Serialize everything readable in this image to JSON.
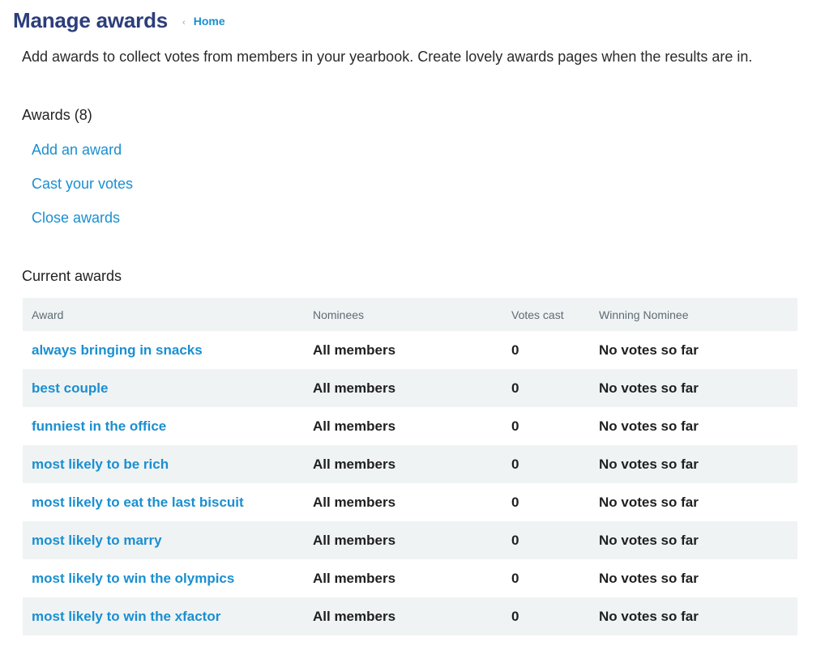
{
  "header": {
    "title": "Manage awards",
    "breadcrumb_sep": "‹",
    "breadcrumb_home": "Home"
  },
  "intro": "Add awards to collect votes from members in your yearbook. Create lovely awards pages when the results are in.",
  "awards_section": {
    "heading": "Awards (8)",
    "actions": [
      {
        "label": "Add an award"
      },
      {
        "label": "Cast your votes"
      },
      {
        "label": "Close awards"
      }
    ]
  },
  "current": {
    "heading": "Current awards",
    "columns": [
      "Award",
      "Nominees",
      "Votes cast",
      "Winning Nominee"
    ],
    "rows": [
      {
        "award": "always bringing in snacks",
        "nominees": "All members",
        "votes": "0",
        "winner": "No votes so far"
      },
      {
        "award": "best couple",
        "nominees": "All members",
        "votes": "0",
        "winner": "No votes so far"
      },
      {
        "award": "funniest in the office",
        "nominees": "All members",
        "votes": "0",
        "winner": "No votes so far"
      },
      {
        "award": "most likely to be rich",
        "nominees": "All members",
        "votes": "0",
        "winner": "No votes so far"
      },
      {
        "award": "most likely to eat the last biscuit",
        "nominees": "All members",
        "votes": "0",
        "winner": "No votes so far"
      },
      {
        "award": "most likely to marry",
        "nominees": "All members",
        "votes": "0",
        "winner": "No votes so far"
      },
      {
        "award": "most likely to win the olympics",
        "nominees": "All members",
        "votes": "0",
        "winner": "No votes so far"
      },
      {
        "award": "most likely to win the xfactor",
        "nominees": "All members",
        "votes": "0",
        "winner": "No votes so far"
      }
    ]
  },
  "colors": {
    "title": "#2c3e7a",
    "link": "#1a8fd1",
    "row_alt": "#eff3f4"
  }
}
